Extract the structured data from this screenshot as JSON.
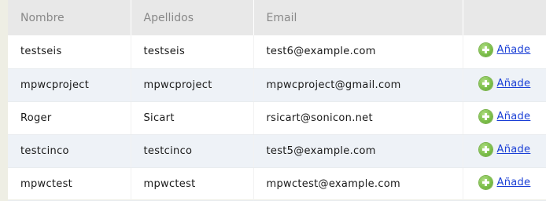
{
  "table": {
    "headers": [
      "Nombre",
      "Apellidos",
      "Email",
      ""
    ],
    "rows": [
      {
        "nombre": "testseis",
        "apellidos": "testseis",
        "email": "test6@example.com",
        "action": "Añade"
      },
      {
        "nombre": "mpwcproject",
        "apellidos": "mpwcproject",
        "email": "mpwcproject@gmail.com",
        "action": "Añade"
      },
      {
        "nombre": "Roger",
        "apellidos": "Sicart",
        "email": "rsicart@sonicon.net",
        "action": "Añade"
      },
      {
        "nombre": "testcinco",
        "apellidos": "testcinco",
        "email": "test5@example.com",
        "action": "Añade"
      },
      {
        "nombre": "mpwctest",
        "apellidos": "mpwctest",
        "email": "mpwctest@example.com",
        "action": "Añade"
      }
    ]
  },
  "icons": {
    "add": "plus-circle-icon"
  },
  "colors": {
    "header_bg": "#e8e8e8",
    "header_text": "#888888",
    "alt_row_bg": "#eef2f7",
    "link": "#1a3fd6",
    "add_icon": "#7cbf4a"
  }
}
